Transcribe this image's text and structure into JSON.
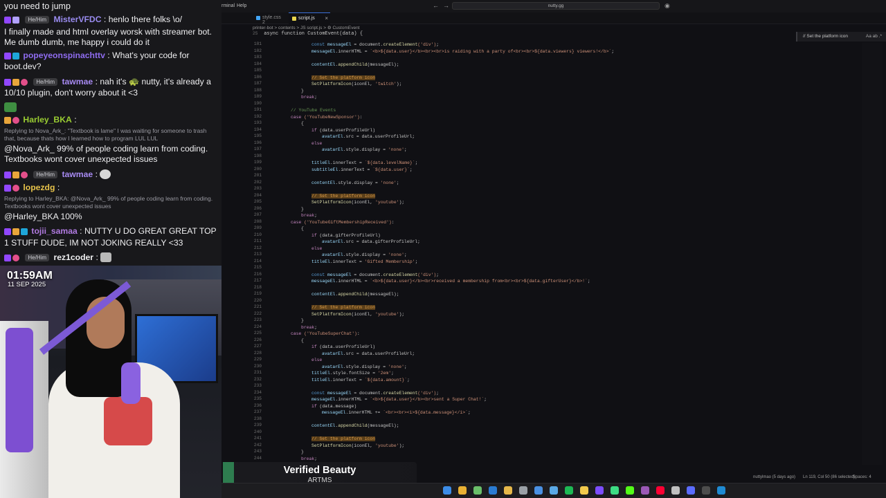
{
  "chat": {
    "top_text": "you need to jump",
    "messages": [
      {
        "user": "MisterVFDC",
        "color": "#9a8cf0",
        "pronoun": "He/Him",
        "text": ": henlo there folks \\o/"
      },
      {
        "user": "",
        "color": "#efeff1",
        "pronoun": "",
        "text": "I finally made and html overlay worsk with streamer bot. Me dumb dumb, me happy i could do it"
      },
      {
        "user": "popeyeonspinachttv",
        "color": "#8f6cf0",
        "pronoun": "",
        "text": ": What's your code for boot.dev?"
      },
      {
        "user": "tawmae",
        "color": "#a78af2",
        "pronoun": "He/Him",
        "text": ": nah it's 🐢 nutty, it's already a 10/10 plugin, don't worry about it <3"
      },
      {
        "user": "Harley_BKA",
        "color": "#9acd32",
        "pronoun": "",
        "text": ":",
        "reply": "Replying to Nova_Ark_: \"Textbook is lame\" I was waiting for someone to trash that, because thats how I learned how to program LUL LUL"
      },
      {
        "user": "",
        "color": "#efeff1",
        "pronoun": "",
        "text": "@Nova_Ark_ 99% of people coding learn from coding. Textbooks wont cover unexpected issues"
      },
      {
        "user": "tawmae",
        "color": "#a78af2",
        "pronoun": "He/Him",
        "text": ":"
      },
      {
        "user": "lopezdg",
        "color": "#e7c34a",
        "pronoun": "",
        "text": ":",
        "reply": "Replying to Harley_BKA: @Nova_Ark_ 99% of people coding learn from coding. Textbooks wont cover unexpected issues"
      },
      {
        "user": "",
        "color": "#efeff1",
        "pronoun": "",
        "text": "@Harley_BKA 100%"
      },
      {
        "user": "tojii_samaa",
        "color": "#b07ae0",
        "pronoun": "",
        "text": ": NUTTY U DO GREAT GREAT TOP 1 STUFF DUDE, IM NOT JOKING REALLY <33"
      },
      {
        "user": "rez1coder",
        "color": "#efeff1",
        "pronoun": "He/Him",
        "text": ":"
      }
    ]
  },
  "clock": {
    "time": "01:59AM",
    "date": "11 SEP 2025"
  },
  "editor": {
    "menu": [
      "rminal",
      "Help"
    ],
    "search_text": "nutty.gg",
    "tabs": [
      {
        "label": "style.css 2",
        "icon_color": "#42a5f5",
        "active": false
      },
      {
        "label": "script.js",
        "icon_color": "#e8d44d",
        "active": true
      }
    ],
    "breadcrumb": "printer-bot  >  contents  >  JS script.js  >  ⚙ CustomEvent",
    "sticky_ln": "25",
    "sticky_line": "async function CustomEvent(data) {",
    "find_label": "// Set the platform icon",
    "find_opts": "Aa  ab  .*",
    "lines": [
      {
        "n": "181",
        "t": [
          [
            "c-kw",
            "const "
          ],
          [
            "c-var",
            "messageEl"
          ],
          [
            "c-p",
            " = document."
          ],
          [
            "c-fn",
            "createElement"
          ],
          [
            "c-str",
            "('div')"
          ],
          [
            "c-p",
            ";"
          ]
        ],
        "i": 4
      },
      {
        "n": "182",
        "t": [
          [
            "c-var",
            "messageEl"
          ],
          [
            "c-p",
            ".innerHTML = "
          ],
          [
            "c-str",
            "`<b>${data.user}</b><br><br>is raiding with a party of<br><br>${data.viewers} viewers!</b>`"
          ],
          [
            "c-p",
            ";"
          ]
        ],
        "i": 4
      },
      {
        "n": "183",
        "t": [],
        "i": 0
      },
      {
        "n": "184",
        "t": [
          [
            "c-var",
            "contentEl"
          ],
          [
            "c-p",
            "."
          ],
          [
            "c-fn",
            "appendChild"
          ],
          [
            "c-p",
            "(messageEl);"
          ]
        ],
        "i": 4
      },
      {
        "n": "185",
        "t": [],
        "i": 0
      },
      {
        "n": "186",
        "t": [
          [
            "c-hl",
            "// Set the platform icon"
          ]
        ],
        "i": 4
      },
      {
        "n": "187",
        "t": [
          [
            "c-fn",
            "SetPlatformIcon"
          ],
          [
            "c-p",
            "(iconEl, "
          ],
          [
            "c-str",
            "'twitch'"
          ],
          [
            "c-p",
            ");"
          ]
        ],
        "i": 4
      },
      {
        "n": "188",
        "t": [
          [
            "c-p",
            "}"
          ]
        ],
        "i": 3
      },
      {
        "n": "189",
        "t": [
          [
            "c-ctrl",
            "break"
          ],
          [
            "c-p",
            ";"
          ]
        ],
        "i": 3
      },
      {
        "n": "190",
        "t": [],
        "i": 0
      },
      {
        "n": "191",
        "t": [
          [
            "c-cm",
            "// YouTube Events"
          ]
        ],
        "i": 2
      },
      {
        "n": "192",
        "t": [
          [
            "c-ctrl",
            "case "
          ],
          [
            "c-str",
            "('YouTubeNewSponsor')"
          ],
          [
            "c-p",
            ":"
          ]
        ],
        "i": 2
      },
      {
        "n": "193",
        "t": [
          [
            "c-p",
            "{"
          ]
        ],
        "i": 3
      },
      {
        "n": "194",
        "t": [
          [
            "c-ctrl",
            "if "
          ],
          [
            "c-p",
            "(data.userProfileUrl)"
          ]
        ],
        "i": 4
      },
      {
        "n": "195",
        "t": [
          [
            "c-var",
            "avatarEl"
          ],
          [
            "c-p",
            ".src = data.userProfileUrl;"
          ]
        ],
        "i": 5
      },
      {
        "n": "196",
        "t": [
          [
            "c-ctrl",
            "else"
          ]
        ],
        "i": 4
      },
      {
        "n": "197",
        "t": [
          [
            "c-var",
            "avatarEl"
          ],
          [
            "c-p",
            ".style.display = "
          ],
          [
            "c-str",
            "'none'"
          ],
          [
            "c-p",
            ";"
          ]
        ],
        "i": 5
      },
      {
        "n": "198",
        "t": [],
        "i": 0
      },
      {
        "n": "199",
        "t": [
          [
            "c-var",
            "titleEl"
          ],
          [
            "c-p",
            ".innerText = "
          ],
          [
            "c-str",
            "`${data.levelName}`"
          ],
          [
            "c-p",
            ";"
          ]
        ],
        "i": 4
      },
      {
        "n": "200",
        "t": [
          [
            "c-var",
            "subtitleEl"
          ],
          [
            "c-p",
            ".innerText = "
          ],
          [
            "c-str",
            "`${data.user}`"
          ],
          [
            "c-p",
            ";"
          ]
        ],
        "i": 4
      },
      {
        "n": "201",
        "t": [],
        "i": 0
      },
      {
        "n": "202",
        "t": [
          [
            "c-var",
            "contentEl"
          ],
          [
            "c-p",
            ".style.display = "
          ],
          [
            "c-str",
            "'none'"
          ],
          [
            "c-p",
            ";"
          ]
        ],
        "i": 4
      },
      {
        "n": "203",
        "t": [],
        "i": 0
      },
      {
        "n": "204",
        "t": [
          [
            "c-hl",
            "// Set the platform icon"
          ]
        ],
        "i": 4
      },
      {
        "n": "205",
        "t": [
          [
            "c-fn",
            "SetPlatformIcon"
          ],
          [
            "c-p",
            "(iconEl, "
          ],
          [
            "c-str",
            "'youtube'"
          ],
          [
            "c-p",
            ");"
          ]
        ],
        "i": 4
      },
      {
        "n": "206",
        "t": [
          [
            "c-p",
            "}"
          ]
        ],
        "i": 3
      },
      {
        "n": "207",
        "t": [
          [
            "c-ctrl",
            "break"
          ],
          [
            "c-p",
            ";"
          ]
        ],
        "i": 3
      },
      {
        "n": "208",
        "t": [
          [
            "c-ctrl",
            "case "
          ],
          [
            "c-str",
            "('YouTubeGiftMembershipReceived')"
          ],
          [
            "c-p",
            ":"
          ]
        ],
        "i": 2
      },
      {
        "n": "209",
        "t": [
          [
            "c-p",
            "{"
          ]
        ],
        "i": 3
      },
      {
        "n": "210",
        "t": [
          [
            "c-ctrl",
            "if "
          ],
          [
            "c-p",
            "(data.gifterProfileUrl)"
          ]
        ],
        "i": 4
      },
      {
        "n": "211",
        "t": [
          [
            "c-var",
            "avatarEl"
          ],
          [
            "c-p",
            ".src = data.gifterProfileUrl;"
          ]
        ],
        "i": 5
      },
      {
        "n": "212",
        "t": [
          [
            "c-ctrl",
            "else"
          ]
        ],
        "i": 4
      },
      {
        "n": "213",
        "t": [
          [
            "c-var",
            "avatarEl"
          ],
          [
            "c-p",
            ".style.display = "
          ],
          [
            "c-str",
            "'none'"
          ],
          [
            "c-p",
            ";"
          ]
        ],
        "i": 5
      },
      {
        "n": "214",
        "t": [
          [
            "c-var",
            "titleEl"
          ],
          [
            "c-p",
            ".innerText = "
          ],
          [
            "c-str",
            "'Gifted Membership'"
          ],
          [
            "c-p",
            ";"
          ]
        ],
        "i": 4
      },
      {
        "n": "215",
        "t": [],
        "i": 0
      },
      {
        "n": "216",
        "t": [
          [
            "c-kw",
            "const "
          ],
          [
            "c-var",
            "messageEl"
          ],
          [
            "c-p",
            " = document."
          ],
          [
            "c-fn",
            "createElement"
          ],
          [
            "c-str",
            "('div')"
          ],
          [
            "c-p",
            ";"
          ]
        ],
        "i": 4
      },
      {
        "n": "217",
        "t": [
          [
            "c-var",
            "messageEl"
          ],
          [
            "c-p",
            ".innerHTML = "
          ],
          [
            "c-str",
            "`<b>${data.user}</b><br>received a membership from<br><br>${data.gifterUser}</b>!`"
          ],
          [
            "c-p",
            ";"
          ]
        ],
        "i": 4
      },
      {
        "n": "218",
        "t": [],
        "i": 0
      },
      {
        "n": "219",
        "t": [
          [
            "c-var",
            "contentEl"
          ],
          [
            "c-p",
            "."
          ],
          [
            "c-fn",
            "appendChild"
          ],
          [
            "c-p",
            "(messageEl);"
          ]
        ],
        "i": 4
      },
      {
        "n": "220",
        "t": [],
        "i": 0
      },
      {
        "n": "221",
        "t": [
          [
            "c-hl",
            "// Set the platform icon"
          ]
        ],
        "i": 4
      },
      {
        "n": "222",
        "t": [
          [
            "c-fn",
            "SetPlatformIcon"
          ],
          [
            "c-p",
            "(iconEl, "
          ],
          [
            "c-str",
            "'youtube'"
          ],
          [
            "c-p",
            ");"
          ]
        ],
        "i": 4
      },
      {
        "n": "223",
        "t": [
          [
            "c-p",
            "}"
          ]
        ],
        "i": 3
      },
      {
        "n": "224",
        "t": [
          [
            "c-ctrl",
            "break"
          ],
          [
            "c-p",
            ";"
          ]
        ],
        "i": 3
      },
      {
        "n": "225",
        "t": [
          [
            "c-ctrl",
            "case "
          ],
          [
            "c-str",
            "('YouTubeSuperChat')"
          ],
          [
            "c-p",
            ":"
          ]
        ],
        "i": 2
      },
      {
        "n": "226",
        "t": [
          [
            "c-p",
            "{"
          ]
        ],
        "i": 3
      },
      {
        "n": "227",
        "t": [
          [
            "c-ctrl",
            "if "
          ],
          [
            "c-p",
            "(data.userProfileUrl)"
          ]
        ],
        "i": 4
      },
      {
        "n": "228",
        "t": [
          [
            "c-var",
            "avatarEl"
          ],
          [
            "c-p",
            ".src = data.userProfileUrl;"
          ]
        ],
        "i": 5
      },
      {
        "n": "229",
        "t": [
          [
            "c-ctrl",
            "else"
          ]
        ],
        "i": 4
      },
      {
        "n": "230",
        "t": [
          [
            "c-var",
            "avatarEl"
          ],
          [
            "c-p",
            ".style.display = "
          ],
          [
            "c-str",
            "'none'"
          ],
          [
            "c-p",
            ";"
          ]
        ],
        "i": 5
      },
      {
        "n": "231",
        "t": [
          [
            "c-var",
            "titleEl"
          ],
          [
            "c-p",
            ".style.fontSize = "
          ],
          [
            "c-str",
            "'2em'"
          ],
          [
            "c-p",
            ";"
          ]
        ],
        "i": 4
      },
      {
        "n": "232",
        "t": [
          [
            "c-var",
            "titleEl"
          ],
          [
            "c-p",
            ".innerText = "
          ],
          [
            "c-str",
            "`${data.amount}`"
          ],
          [
            "c-p",
            ";"
          ]
        ],
        "i": 4
      },
      {
        "n": "233",
        "t": [],
        "i": 0
      },
      {
        "n": "234",
        "t": [
          [
            "c-kw",
            "const "
          ],
          [
            "c-var",
            "messageEl"
          ],
          [
            "c-p",
            " = document."
          ],
          [
            "c-fn",
            "createElement"
          ],
          [
            "c-str",
            "('div')"
          ],
          [
            "c-p",
            ";"
          ]
        ],
        "i": 4
      },
      {
        "n": "235",
        "t": [
          [
            "c-var",
            "messageEl"
          ],
          [
            "c-p",
            ".innerHTML = "
          ],
          [
            "c-str",
            "`<b>${data.user}</b><br>sent a Super Chat!`"
          ],
          [
            "c-p",
            ";"
          ]
        ],
        "i": 4
      },
      {
        "n": "236",
        "t": [
          [
            "c-ctrl",
            "if "
          ],
          [
            "c-p",
            "(data.message)"
          ]
        ],
        "i": 4
      },
      {
        "n": "237",
        "t": [
          [
            "c-var",
            "messageEl"
          ],
          [
            "c-p",
            ".innerHTML += "
          ],
          [
            "c-str",
            "`<br><br><i>${data.message}</i>`"
          ],
          [
            "c-p",
            ";"
          ]
        ],
        "i": 5
      },
      {
        "n": "238",
        "t": [],
        "i": 0
      },
      {
        "n": "239",
        "t": [
          [
            "c-var",
            "contentEl"
          ],
          [
            "c-p",
            "."
          ],
          [
            "c-fn",
            "appendChild"
          ],
          [
            "c-p",
            "(messageEl);"
          ]
        ],
        "i": 4
      },
      {
        "n": "240",
        "t": [],
        "i": 0
      },
      {
        "n": "241",
        "t": [
          [
            "c-hl",
            "// Set the platform icon"
          ]
        ],
        "i": 4
      },
      {
        "n": "242",
        "t": [
          [
            "c-fn",
            "SetPlatformIcon"
          ],
          [
            "c-p",
            "(iconEl, "
          ],
          [
            "c-str",
            "'youtube'"
          ],
          [
            "c-p",
            ");"
          ]
        ],
        "i": 4
      },
      {
        "n": "243",
        "t": [
          [
            "c-p",
            "}"
          ]
        ],
        "i": 3
      },
      {
        "n": "244",
        "t": [
          [
            "c-ctrl",
            "break"
          ],
          [
            "c-p",
            ";"
          ]
        ],
        "i": 3
      }
    ],
    "status": {
      "blame": "nuttylmao (5 days ago)",
      "position": "Ln 119, Col 50 (86 selected)",
      "spaces": "Spaces: 4"
    }
  },
  "now_playing": {
    "title": "Verified Beauty",
    "artist": "ARTMS"
  },
  "taskbar": {
    "icons": [
      {
        "name": "windows-start-icon",
        "color": "#3c8ce7"
      },
      {
        "name": "chrome-icon",
        "color": "#e9b133"
      },
      {
        "name": "chrome-dev-icon",
        "color": "#6abf69"
      },
      {
        "name": "vscode-alt-icon",
        "color": "#2a7bd2"
      },
      {
        "name": "file-explorer-icon",
        "color": "#e6b84a"
      },
      {
        "name": "settings-icon",
        "color": "#9aa0a6"
      },
      {
        "name": "app-icon",
        "color": "#4a90e2"
      },
      {
        "name": "drive-icon",
        "color": "#5aa9e6"
      },
      {
        "name": "spotify-icon",
        "color": "#1db954"
      },
      {
        "name": "notes-icon",
        "color": "#f2c94c"
      },
      {
        "name": "obsidian-icon",
        "color": "#7c4dff"
      },
      {
        "name": "android-studio-icon",
        "color": "#3ddc84"
      },
      {
        "name": "kick-icon",
        "color": "#53fc18"
      },
      {
        "name": "app2-icon",
        "color": "#9b59b6"
      },
      {
        "name": "youtube-icon",
        "color": "#ff0033"
      },
      {
        "name": "app3-icon",
        "color": "#c0c0c0"
      },
      {
        "name": "app4-icon",
        "color": "#5b6cff"
      },
      {
        "name": "terminal-icon",
        "color": "#4d4d4d"
      },
      {
        "name": "vscode-icon",
        "color": "#1f8ad2"
      }
    ]
  }
}
